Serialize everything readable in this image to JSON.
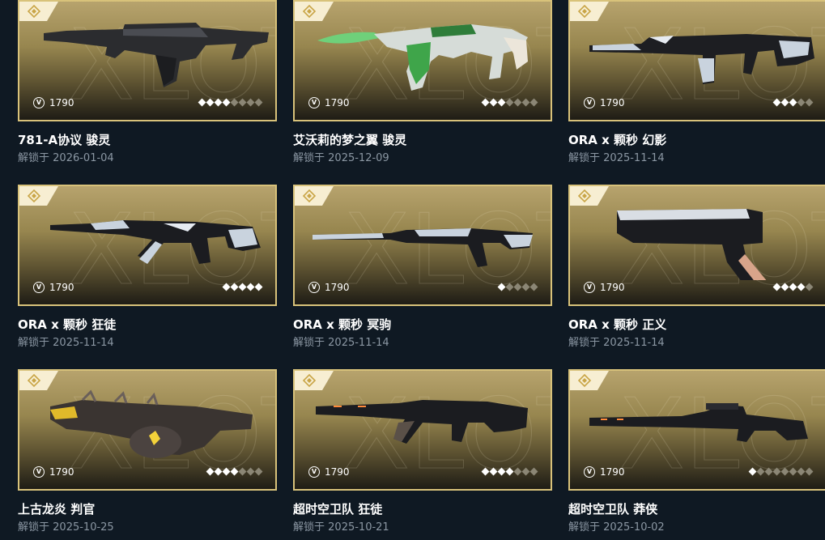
{
  "icons": {
    "vp": "vp-currency-icon",
    "tier": "tier-diamond-icon",
    "level": "level-diamond-icon"
  },
  "colors": {
    "card_border": "#d8c27a",
    "page_bg": "#0f1923",
    "level_on": "#ffffff",
    "level_off": "#8b8675"
  },
  "cards": [
    {
      "name": "781-A协议 骏灵",
      "unlock_label": "解锁于",
      "date": "2026-01-04",
      "price": "1790",
      "levels_on": 4,
      "levels_total": 8,
      "style": "dark"
    },
    {
      "name": "艾沃莉的梦之翼 骏灵",
      "unlock_label": "解锁于",
      "date": "2025-12-09",
      "price": "1790",
      "levels_on": 3,
      "levels_total": 7,
      "style": "green"
    },
    {
      "name": "ORA x 颗秒 幻影",
      "unlock_label": "解锁于",
      "date": "2025-11-14",
      "price": "1790",
      "levels_on": 3,
      "levels_total": 5,
      "style": "ora"
    },
    {
      "name": "ORA x 颗秒 狂徒",
      "unlock_label": "解锁于",
      "date": "2025-11-14",
      "price": "1790",
      "levels_on": 5,
      "levels_total": 5,
      "style": "ora"
    },
    {
      "name": "ORA x 颗秒 冥驹",
      "unlock_label": "解锁于",
      "date": "2025-11-14",
      "price": "1790",
      "levels_on": 1,
      "levels_total": 5,
      "style": "ora"
    },
    {
      "name": "ORA x 颗秒 正义",
      "unlock_label": "解锁于",
      "date": "2025-11-14",
      "price": "1790",
      "levels_on": 4,
      "levels_total": 5,
      "style": "pistol"
    },
    {
      "name": "上古龙炎 判官",
      "unlock_label": "解锁于",
      "date": "2025-10-25",
      "price": "1790",
      "levels_on": 4,
      "levels_total": 7,
      "style": "dragon"
    },
    {
      "name": "超时空卫队 狂徒",
      "unlock_label": "解锁于",
      "date": "2025-10-21",
      "price": "1790",
      "levels_on": 4,
      "levels_total": 7,
      "style": "dark"
    },
    {
      "name": "超时空卫队 莽侠",
      "unlock_label": "解锁于",
      "date": "2025-10-02",
      "price": "1790",
      "levels_on": 1,
      "levels_total": 8,
      "style": "dark"
    }
  ]
}
